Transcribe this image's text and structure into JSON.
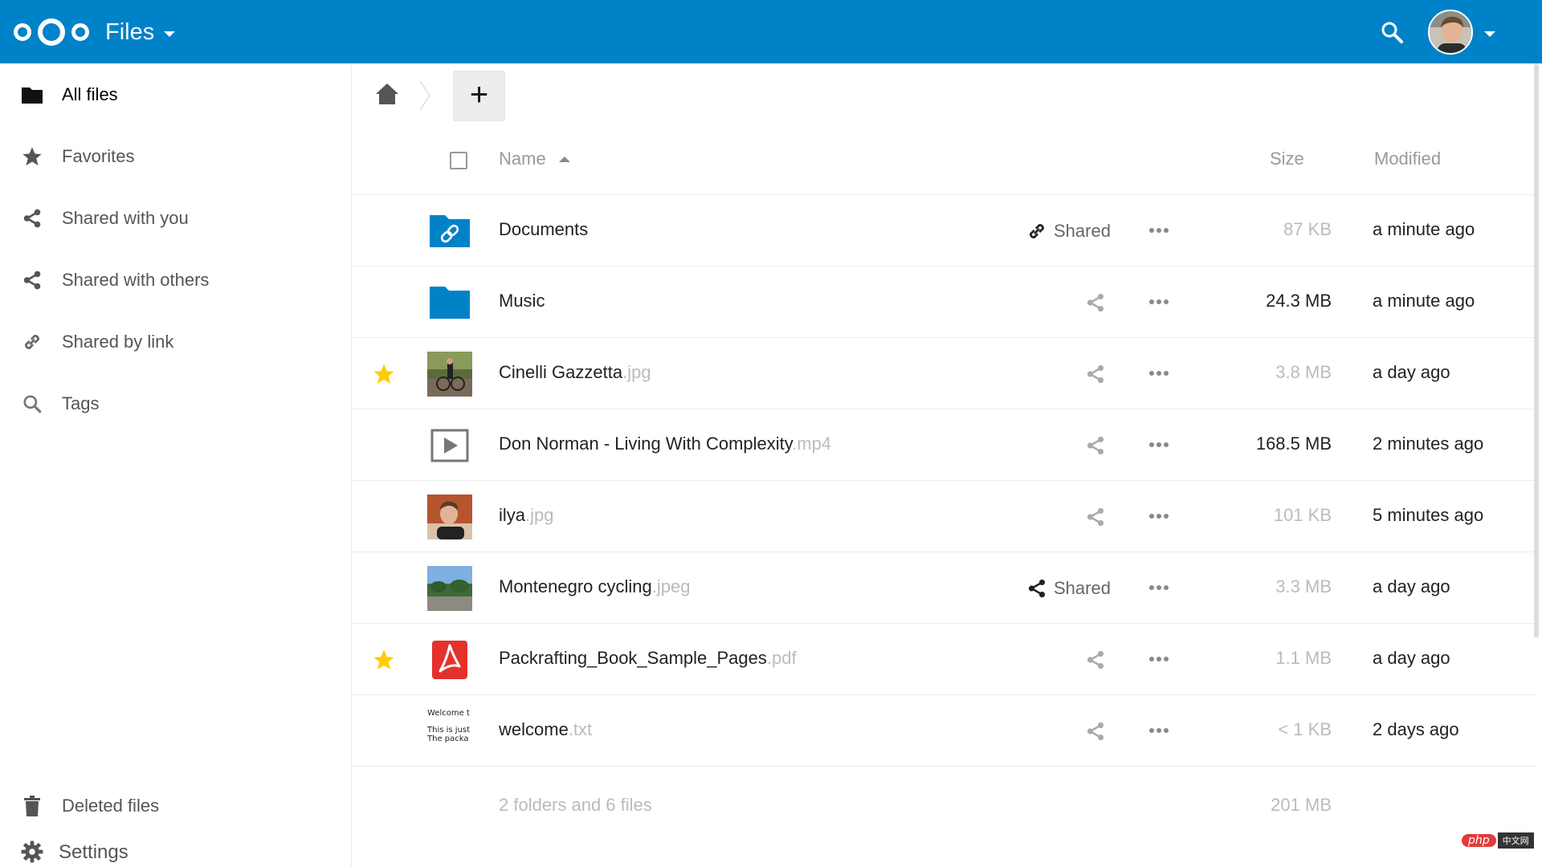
{
  "header": {
    "app_title": "Files"
  },
  "sidebar": {
    "items": [
      {
        "label": "All files",
        "icon": "folder-icon"
      },
      {
        "label": "Favorites",
        "icon": "star-icon"
      },
      {
        "label": "Shared with you",
        "icon": "share-icon"
      },
      {
        "label": "Shared with others",
        "icon": "share-icon"
      },
      {
        "label": "Shared by link",
        "icon": "link-icon"
      },
      {
        "label": "Tags",
        "icon": "search-icon"
      }
    ],
    "bottom": [
      {
        "label": "Deleted files",
        "icon": "trash-icon"
      },
      {
        "label": "Settings",
        "icon": "gear-icon"
      }
    ]
  },
  "toolbar": {
    "add_label": "+"
  },
  "table": {
    "headers": {
      "name": "Name",
      "size": "Size",
      "modified": "Modified"
    },
    "rows": [
      {
        "name": "Documents",
        "ext": "",
        "favorite": false,
        "type": "shared-folder",
        "share_label": "Shared",
        "share_type": "link",
        "size": "87 KB",
        "size_emph": false,
        "modified": "a minute ago"
      },
      {
        "name": "Music",
        "ext": "",
        "favorite": false,
        "type": "folder",
        "share_label": "",
        "share_type": "none",
        "size": "24.3 MB",
        "size_emph": true,
        "modified": "a minute ago"
      },
      {
        "name": "Cinelli Gazzetta",
        "ext": ".jpg",
        "favorite": true,
        "type": "image-bike",
        "share_label": "",
        "share_type": "none",
        "size": "3.8 MB",
        "size_emph": false,
        "modified": "a day ago"
      },
      {
        "name": "Don Norman - Living With Complexity",
        "ext": ".mp4",
        "favorite": false,
        "type": "video",
        "share_label": "",
        "share_type": "none",
        "size": "168.5 MB",
        "size_emph": true,
        "modified": "2 minutes ago"
      },
      {
        "name": "ilya",
        "ext": ".jpg",
        "favorite": false,
        "type": "image-person",
        "share_label": "",
        "share_type": "none",
        "size": "101 KB",
        "size_emph": false,
        "modified": "5 minutes ago"
      },
      {
        "name": "Montenegro cycling",
        "ext": ".jpeg",
        "favorite": false,
        "type": "image-landscape",
        "share_label": "Shared",
        "share_type": "share",
        "size": "3.3 MB",
        "size_emph": false,
        "modified": "a day ago"
      },
      {
        "name": "Packrafting_Book_Sample_Pages",
        "ext": ".pdf",
        "favorite": true,
        "type": "pdf",
        "share_label": "",
        "share_type": "none",
        "size": "1.1 MB",
        "size_emph": false,
        "modified": "a day ago"
      },
      {
        "name": "welcome",
        "ext": ".txt",
        "favorite": false,
        "type": "text",
        "share_label": "",
        "share_type": "none",
        "size": "< 1 KB",
        "size_emph": false,
        "modified": "2 days ago"
      }
    ],
    "text_preview": [
      "Welcome t",
      "This is just",
      "The packa"
    ],
    "summary": "2 folders and 6 files",
    "total_size": "201 MB"
  },
  "watermark": {
    "php": "php",
    "cn": "中文网"
  },
  "colors": {
    "brand": "#0082c9",
    "star": "#fc0",
    "pdf": "#e4312b"
  }
}
